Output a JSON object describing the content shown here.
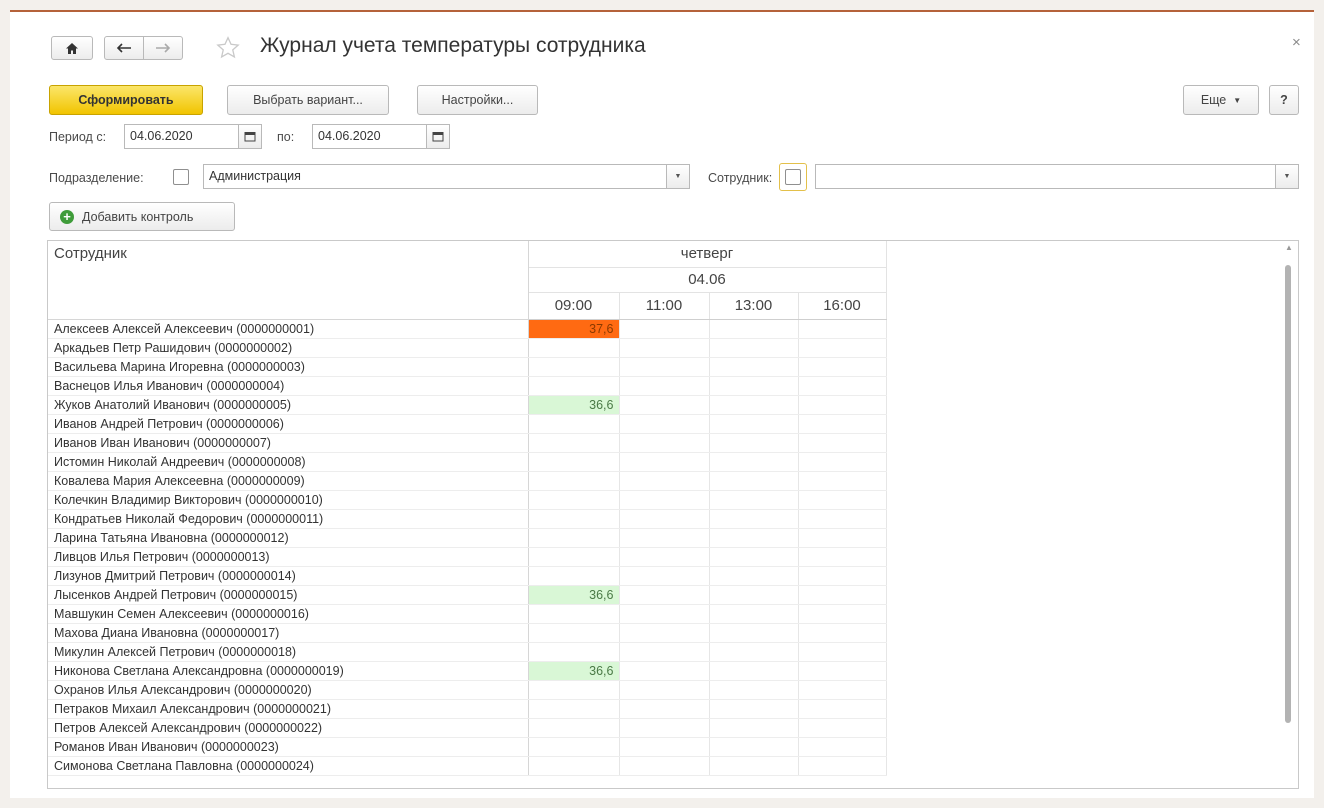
{
  "window": {
    "title": "Журнал учета температуры сотрудника",
    "close": "×"
  },
  "nav": {
    "home_icon": "home-icon",
    "back_icon": "arrow-left-icon",
    "forward_icon": "arrow-right-icon",
    "favorite_icon": "star-icon"
  },
  "toolbar": {
    "generate": "Сформировать",
    "select_variant": "Выбрать вариант...",
    "settings": "Настройки...",
    "more": "Еще",
    "help": "?"
  },
  "filters": {
    "period_label": "Период с:",
    "period_from": "04.06.2020",
    "period_to_label": "по:",
    "period_to": "04.06.2020",
    "department_label": "Подразделение:",
    "department_checked": false,
    "department_value": "Администрация",
    "employee_label": "Сотрудник:",
    "employee_checked": false,
    "employee_value": "",
    "add_control": "Добавить контроль"
  },
  "report": {
    "employee_header": "Сотрудник",
    "day": "четверг",
    "date": "04.06",
    "times": [
      "09:00",
      "11:00",
      "13:00",
      "16:00"
    ],
    "rows": [
      {
        "name": "Алексеев Алексей Алексеевич (0000000001)",
        "t0900": "37,6",
        "status": "hot"
      },
      {
        "name": "Аркадьев Петр Рашидович (0000000002)",
        "t0900": "",
        "status": ""
      },
      {
        "name": "Васильева Марина Игоревна (0000000003)",
        "t0900": "",
        "status": ""
      },
      {
        "name": "Васнецов Илья Иванович (0000000004)",
        "t0900": "",
        "status": ""
      },
      {
        "name": "Жуков Анатолий Иванович (0000000005)",
        "t0900": "36,6",
        "status": "ok"
      },
      {
        "name": "Иванов Андрей Петрович (0000000006)",
        "t0900": "",
        "status": ""
      },
      {
        "name": "Иванов Иван Иванович (0000000007)",
        "t0900": "",
        "status": ""
      },
      {
        "name": "Истомин Николай Андреевич (0000000008)",
        "t0900": "",
        "status": ""
      },
      {
        "name": "Ковалева Мария Алексеевна (0000000009)",
        "t0900": "",
        "status": ""
      },
      {
        "name": "Колечкин Владимир Викторович (0000000010)",
        "t0900": "",
        "status": ""
      },
      {
        "name": "Кондратьев Николай Федорович (0000000011)",
        "t0900": "",
        "status": ""
      },
      {
        "name": "Ларина Татьяна Ивановна (0000000012)",
        "t0900": "",
        "status": ""
      },
      {
        "name": "Ливцов Илья Петрович (0000000013)",
        "t0900": "",
        "status": ""
      },
      {
        "name": "Лизунов Дмитрий Петрович (0000000014)",
        "t0900": "",
        "status": ""
      },
      {
        "name": "Лысенков Андрей Петрович (0000000015)",
        "t0900": "36,6",
        "status": "ok"
      },
      {
        "name": "Мавшукин Семен Алексеевич (0000000016)",
        "t0900": "",
        "status": ""
      },
      {
        "name": "Махова Диана Ивановна (0000000017)",
        "t0900": "",
        "status": ""
      },
      {
        "name": "Микулин Алексей Петрович (0000000018)",
        "t0900": "",
        "status": ""
      },
      {
        "name": "Никонова Светлана Александровна (0000000019)",
        "t0900": "36,6",
        "status": "ok"
      },
      {
        "name": "Охранов Илья  Александрович (0000000020)",
        "t0900": "",
        "status": ""
      },
      {
        "name": "Петраков Михаил Александрович (0000000021)",
        "t0900": "",
        "status": ""
      },
      {
        "name": "Петров  Алексей Александрович (0000000022)",
        "t0900": "",
        "status": ""
      },
      {
        "name": "Романов Иван Иванович (0000000023)",
        "t0900": "",
        "status": ""
      },
      {
        "name": "Симонова Светлана Павловна (0000000024)",
        "t0900": "",
        "status": ""
      }
    ]
  },
  "colors": {
    "generate_button": "#f5d218",
    "hot_cell": "#ff6a12",
    "ok_cell": "#d9f7d6",
    "window_border": "#b5623a"
  }
}
